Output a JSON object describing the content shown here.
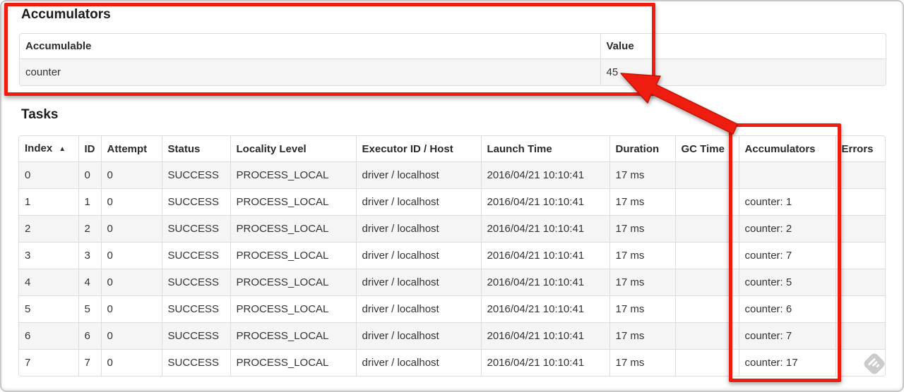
{
  "annotation": {
    "color": "#ee1d0f",
    "outline_color": "#c11507"
  },
  "accumulators_section": {
    "heading": "Accumulators",
    "table": {
      "headers": [
        "Accumulable",
        "Value"
      ],
      "rows": [
        [
          "counter",
          "45"
        ]
      ]
    }
  },
  "tasks_section": {
    "heading": "Tasks",
    "sort_icon": "▲",
    "table": {
      "headers": [
        "Index",
        "ID",
        "Attempt",
        "Status",
        "Locality Level",
        "Executor ID / Host",
        "Launch Time",
        "Duration",
        "GC Time",
        "Accumulators",
        "Errors"
      ],
      "rows": [
        [
          "0",
          "0",
          "0",
          "SUCCESS",
          "PROCESS_LOCAL",
          "driver / localhost",
          "2016/04/21 10:10:41",
          "17 ms",
          "",
          "",
          ""
        ],
        [
          "1",
          "1",
          "0",
          "SUCCESS",
          "PROCESS_LOCAL",
          "driver / localhost",
          "2016/04/21 10:10:41",
          "17 ms",
          "",
          "counter: 1",
          ""
        ],
        [
          "2",
          "2",
          "0",
          "SUCCESS",
          "PROCESS_LOCAL",
          "driver / localhost",
          "2016/04/21 10:10:41",
          "17 ms",
          "",
          "counter: 2",
          ""
        ],
        [
          "3",
          "3",
          "0",
          "SUCCESS",
          "PROCESS_LOCAL",
          "driver / localhost",
          "2016/04/21 10:10:41",
          "17 ms",
          "",
          "counter: 7",
          ""
        ],
        [
          "4",
          "4",
          "0",
          "SUCCESS",
          "PROCESS_LOCAL",
          "driver / localhost",
          "2016/04/21 10:10:41",
          "17 ms",
          "",
          "counter: 5",
          ""
        ],
        [
          "5",
          "5",
          "0",
          "SUCCESS",
          "PROCESS_LOCAL",
          "driver / localhost",
          "2016/04/21 10:10:41",
          "17 ms",
          "",
          "counter: 6",
          ""
        ],
        [
          "6",
          "6",
          "0",
          "SUCCESS",
          "PROCESS_LOCAL",
          "driver / localhost",
          "2016/04/21 10:10:41",
          "17 ms",
          "",
          "counter: 7",
          ""
        ],
        [
          "7",
          "7",
          "0",
          "SUCCESS",
          "PROCESS_LOCAL",
          "driver / localhost",
          "2016/04/21 10:10:41",
          "17 ms",
          "",
          "counter: 17",
          ""
        ]
      ]
    }
  }
}
